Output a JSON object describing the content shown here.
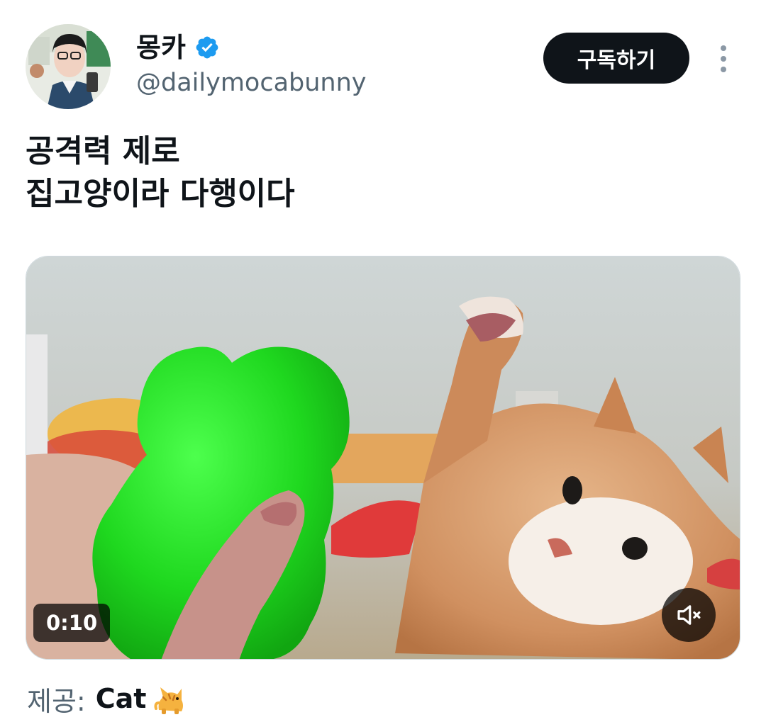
{
  "author": {
    "display_name": "몽카",
    "handle": "@dailymocabunny",
    "verified": true
  },
  "header": {
    "subscribe_label": "구독하기"
  },
  "tweet": {
    "lines": [
      "공격력 제로",
      "집고양이라 다행이다"
    ]
  },
  "media": {
    "duration": "0:10",
    "muted": true
  },
  "credit": {
    "label": "제공:",
    "name": "Cat",
    "emoji_icon": "cat-emoji-icon"
  },
  "colors": {
    "accent_verified": "#1d9bf0",
    "button_bg": "#0f1419",
    "secondary_text": "#536471"
  }
}
